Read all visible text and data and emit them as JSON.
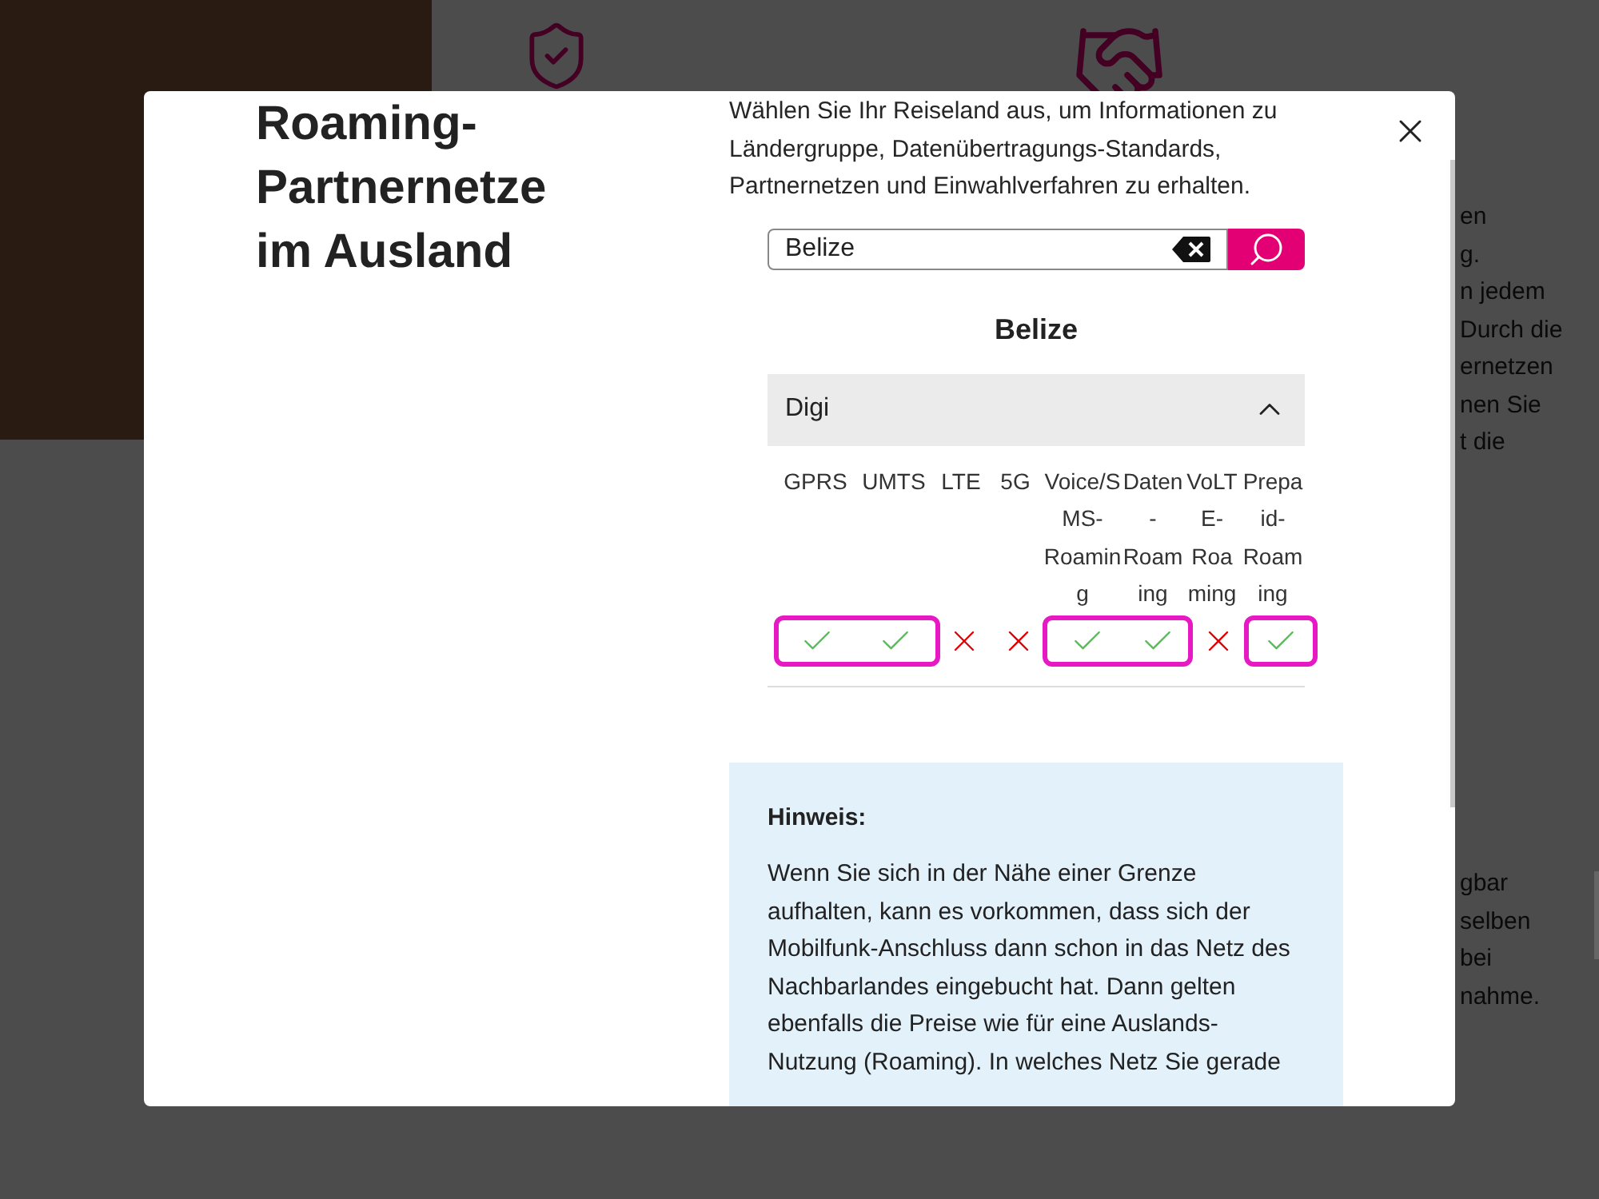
{
  "background": {
    "text_fragments_top": [
      "en",
      "g.",
      "n jedem",
      "Durch die",
      "ernetzen",
      "nen Sie",
      "t die"
    ],
    "text_fragments_bottom": [
      "gbar",
      "selben",
      "bei",
      "nahme."
    ]
  },
  "dialog": {
    "title": "Roaming-Partnernetze im Ausland",
    "intro": "Wählen Sie Ihr Reiseland aus, um Informationen zu Ländergruppe, Datenübertragungs-Standards, Partnernetzen und Einwahlverfahren zu erhalten.",
    "search": {
      "value": "Belize"
    },
    "country": "Belize",
    "networks": [
      {
        "name": "Digi",
        "expanded": true,
        "columns": [
          "GPRS",
          "UMTS",
          "LTE",
          "5G",
          "Voice/SMS-Roaming",
          "Daten-Roaming",
          "VoLTE-Roaming",
          "Prepaid-Roaming"
        ],
        "values": [
          {
            "available": true,
            "highlighted": true
          },
          {
            "available": true,
            "highlighted": true
          },
          {
            "available": false,
            "highlighted": false
          },
          {
            "available": false,
            "highlighted": false
          },
          {
            "available": true,
            "highlighted": true
          },
          {
            "available": true,
            "highlighted": true
          },
          {
            "available": false,
            "highlighted": false
          },
          {
            "available": true,
            "highlighted": true
          }
        ]
      }
    ],
    "notice": {
      "title": "Hinweis:",
      "text": "Wenn Sie sich in der Nähe einer Grenze aufhalten, kann es vorkommen, dass sich der Mobilfunk-Anschluss dann schon in das Netz des Nachbarlandes eingebucht hat. Dann gelten ebenfalls die Preise wie für eine Auslands-Nutzung (Roaming). In welches Netz Sie gerade"
    }
  }
}
